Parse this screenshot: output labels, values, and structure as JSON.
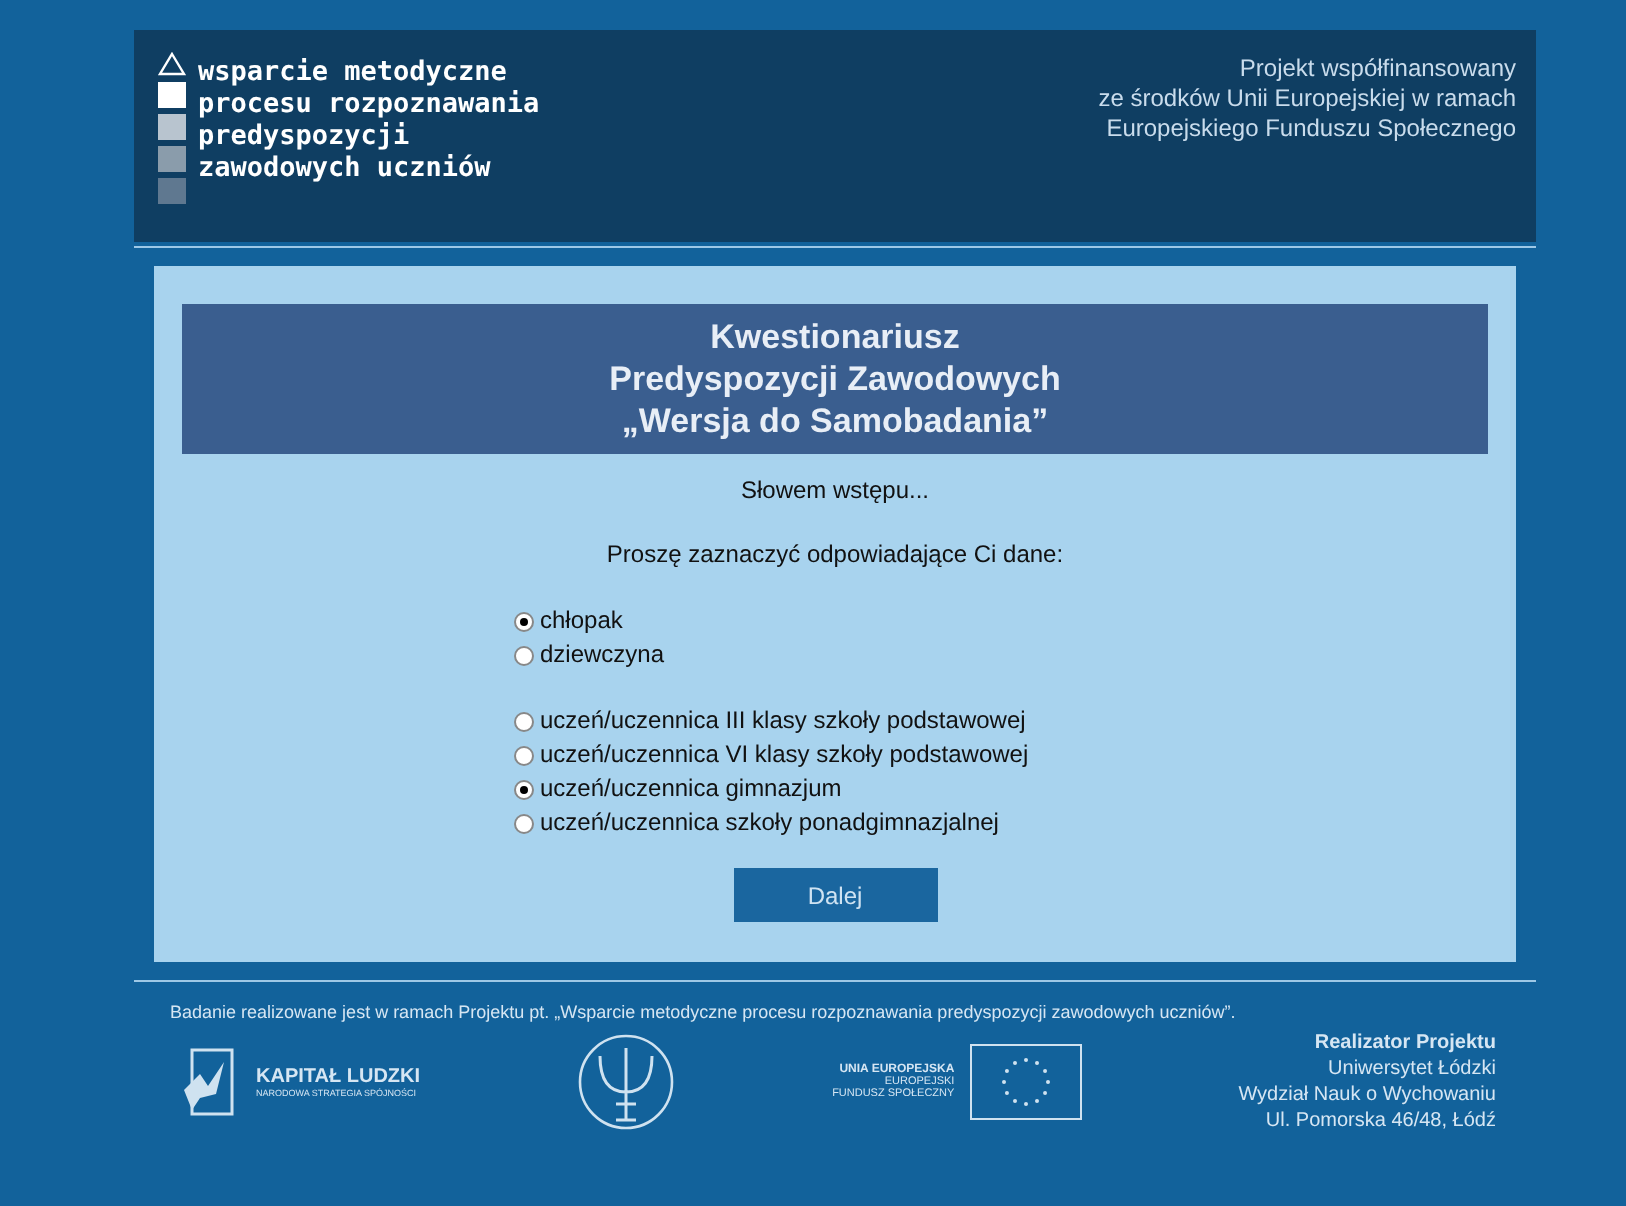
{
  "header": {
    "logo_lines": [
      "wsparcie metodyczne",
      "procesu rozpoznawania",
      "predyspozycji",
      "zawodowych uczniów"
    ],
    "cofinance": [
      "Projekt współfinansowany",
      "ze środków Unii Europejskiej w ramach",
      "Europejskiego Funduszu Społecznego"
    ]
  },
  "title": [
    "Kwestionariusz",
    "Predyspozycji Zawodowych",
    "„Wersja do Samobadania”"
  ],
  "intro": "Słowem wstępu...",
  "prompt": "Proszę zaznaczyć odpowiadające Ci dane:",
  "gender": [
    {
      "label": "chłopak",
      "selected": true
    },
    {
      "label": "dziewczyna",
      "selected": false
    }
  ],
  "school": [
    {
      "label": "uczeń/uczennica III klasy szkoły podstawowej",
      "selected": false
    },
    {
      "label": "uczeń/uczennica VI klasy szkoły podstawowej",
      "selected": false
    },
    {
      "label": "uczeń/uczennica gimnazjum",
      "selected": true
    },
    {
      "label": "uczeń/uczennica szkoły ponadgimnazjalnej",
      "selected": false
    }
  ],
  "next_button": "Dalej",
  "footer": {
    "note": "Badanie realizowane jest w ramach Projektu pt. „Wsparcie metodyczne procesu rozpoznawania predyspozycji zawodowych uczniów”.",
    "kl_logo": {
      "name": "KAPITAŁ LUDZKI",
      "sub": "NARODOWA STRATEGIA SPÓJNOŚCI"
    },
    "eu_logo": [
      "UNIA EUROPEJSKA",
      "EUROPEJSKI",
      "FUNDUSZ SPOŁECZNY"
    ],
    "realizer_title": "Realizator Projektu",
    "realizer_lines": [
      "Uniwersytet Łódzki",
      "Wydział Nauk o Wychowaniu",
      "Ul. Pomorska 46/48, Łódź"
    ]
  }
}
